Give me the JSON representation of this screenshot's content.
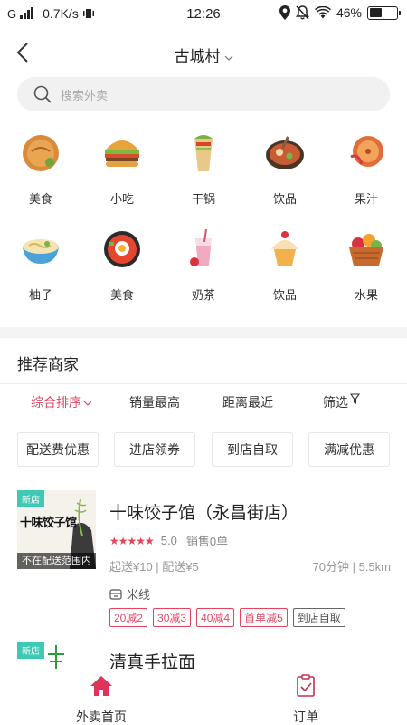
{
  "status": {
    "network": "G",
    "speed": "0.7K/s",
    "time": "12:26",
    "battery": "46%",
    "battery_level": 0.46
  },
  "header": {
    "location": "古城村"
  },
  "search": {
    "placeholder": "搜索外卖"
  },
  "categories": [
    {
      "label": "美食",
      "icon": "pie-icon"
    },
    {
      "label": "小吃",
      "icon": "burger-icon"
    },
    {
      "label": "干锅",
      "icon": "wrap-icon"
    },
    {
      "label": "饮品",
      "icon": "hotpot-icon"
    },
    {
      "label": "果汁",
      "icon": "snack-icon"
    },
    {
      "label": "柚子",
      "icon": "noodle-bowl-icon"
    },
    {
      "label": "美食",
      "icon": "bibimbap-icon"
    },
    {
      "label": "奶茶",
      "icon": "milkshake-icon"
    },
    {
      "label": "饮品",
      "icon": "cupcake-icon"
    },
    {
      "label": "水果",
      "icon": "fruit-basket-icon"
    }
  ],
  "section": {
    "title": "推荐商家"
  },
  "sort": {
    "items": [
      "综合排序",
      "销量最高",
      "距离最近",
      "筛选"
    ]
  },
  "filters": [
    "配送费优惠",
    "进店领券",
    "到店自取",
    "满减优惠"
  ],
  "shops": [
    {
      "name": "十味饺子馆（永昌街店）",
      "badge": "新店",
      "thumb_text": "十味饺子馆",
      "cover_text": "不在配送范围内",
      "rating_stars": "★★★★★",
      "score": "5.0",
      "sales": "销售0单",
      "min_order": "起送¥10 | 配送¥5",
      "delivery": "70分钟 | 5.5km",
      "category": "米线",
      "tags": [
        "20减2",
        "30减3",
        "40减4",
        "首单减5",
        "到店自取"
      ]
    },
    {
      "name": "清真手拉面",
      "badge": "新店"
    }
  ],
  "bottom_nav": [
    {
      "label": "外卖首页",
      "icon": "home-icon",
      "color": "#e0335a"
    },
    {
      "label": "订单",
      "icon": "order-clipboard-icon",
      "color": "#c0304f"
    }
  ],
  "colors": {
    "accent": "#e04a66",
    "new_badge": "#3fc9b5"
  }
}
